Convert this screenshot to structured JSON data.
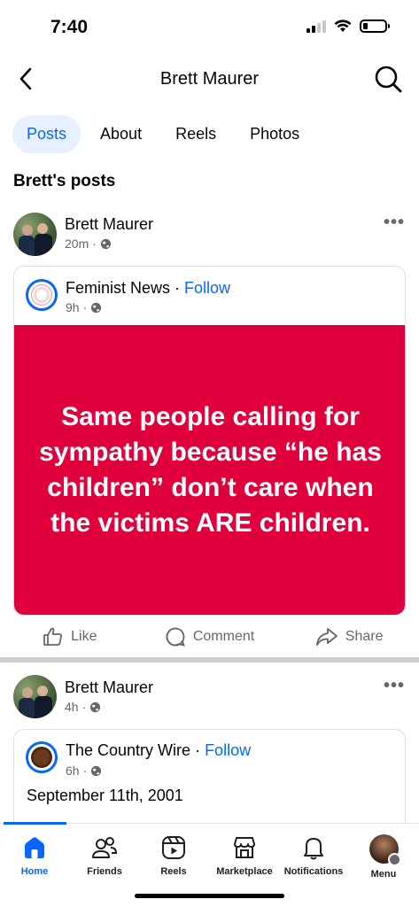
{
  "status_bar": {
    "time": "7:40"
  },
  "header": {
    "title": "Brett Maurer"
  },
  "tabs": [
    {
      "label": "Posts"
    },
    {
      "label": "About"
    },
    {
      "label": "Reels"
    },
    {
      "label": "Photos"
    }
  ],
  "section_title": "Brett's posts",
  "posts": [
    {
      "author": "Brett Maurer",
      "time": "20m",
      "shared": {
        "page_name": "Feminist News",
        "follow": "Follow",
        "time": "9h",
        "image_text": "Same people calling for sympathy because “he has children” don’t care when the victims ARE children."
      },
      "actions": {
        "like": "Like",
        "comment": "Comment",
        "share": "Share"
      }
    },
    {
      "author": "Brett Maurer",
      "time": "4h",
      "shared": {
        "page_name": "The Country Wire",
        "follow": "Follow",
        "time": "6h",
        "text": "September 11th, 2001"
      }
    }
  ],
  "bottom_nav": [
    {
      "label": "Home",
      "icon": "home-icon"
    },
    {
      "label": "Friends",
      "icon": "friends-icon"
    },
    {
      "label": "Reels",
      "icon": "reels-icon"
    },
    {
      "label": "Marketplace",
      "icon": "marketplace-icon"
    },
    {
      "label": "Notifications",
      "icon": "bell-icon"
    },
    {
      "label": "Menu",
      "icon": "avatar"
    }
  ],
  "colors": {
    "accent": "#0866ff",
    "quote_bg": "#e0003b",
    "secondary_text": "#65676b"
  }
}
